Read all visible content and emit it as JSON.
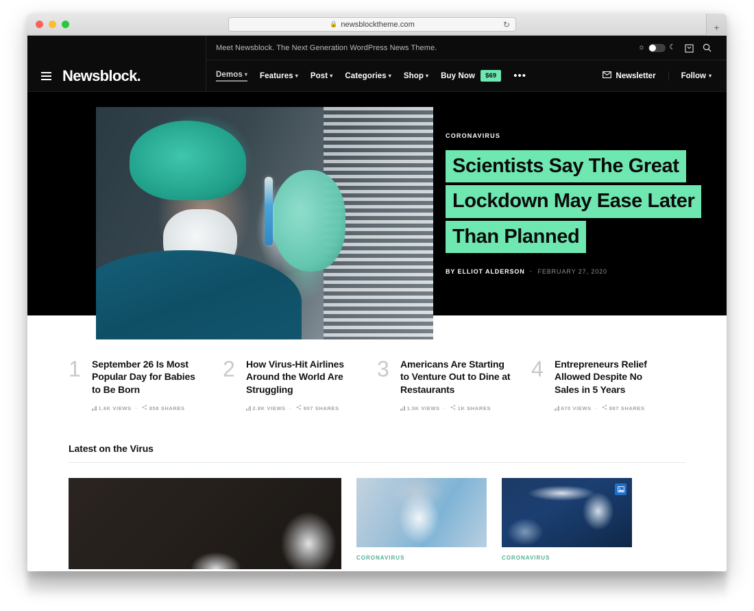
{
  "browser": {
    "url": "newsblocktheme.com",
    "lock_icon": "lock-icon",
    "reload_icon": "reload-icon",
    "newtab_icon": "plus-icon"
  },
  "topbar": {
    "tagline": "Meet Newsblock. The Next Generation WordPress News Theme.",
    "sun_icon": "sun-icon",
    "moon_icon": "moon-icon",
    "cart_icon": "shopping-bag-icon",
    "search_icon": "search-icon",
    "theme_toggle_state": "light"
  },
  "header": {
    "logo": "Newsblock.",
    "menu_icon": "hamburger-icon",
    "menu": [
      {
        "label": "Demos",
        "caret": "⌄",
        "active": true
      },
      {
        "label": "Features",
        "caret": "⌄",
        "active": false
      },
      {
        "label": "Post",
        "caret": "⌄",
        "active": false
      },
      {
        "label": "Categories",
        "caret": "⌄",
        "active": false
      },
      {
        "label": "Shop",
        "caret": "⌄",
        "active": false
      },
      {
        "label": "Buy Now",
        "caret": "",
        "badge": "$69",
        "active": false
      }
    ],
    "more_icon": "•••",
    "newsletter_label": "Newsletter",
    "newsletter_icon": "envelope-icon",
    "follow_label": "Follow",
    "follow_caret": "⌄"
  },
  "hero": {
    "category": "CORONAVIRUS",
    "title_lines": [
      "Scientists Say The Great",
      "Lockdown May Ease Later",
      "Than Planned"
    ],
    "by_prefix": "BY",
    "author": "ELLIOT ALDERSON",
    "separator": "·",
    "date": "FEBRUARY 27, 2020",
    "accent_color": "#6ee7b0"
  },
  "numbered_stories": [
    {
      "number": "1",
      "title": "September 26 Is Most Popular Day for Babies to Be Born",
      "views": "1.6K VIEWS",
      "shares": "858 SHARES"
    },
    {
      "number": "2",
      "title": "How Virus-Hit Airlines Around the World Are Struggling",
      "views": "2.8K VIEWS",
      "shares": "907 SHARES"
    },
    {
      "number": "3",
      "title": "Americans Are Starting to Venture Out to Dine at Restaurants",
      "views": "1.5K VIEWS",
      "shares": "1K SHARES"
    },
    {
      "number": "4",
      "title": "Entrepreneurs Relief Allowed Despite No Sales in 5 Years",
      "views": "670 VIEWS",
      "shares": "887 SHARES"
    }
  ],
  "latest_section": {
    "heading": "Latest on the Virus",
    "cards": [
      {
        "category": "",
        "thumb": "worker-in-protective-suit-dark"
      },
      {
        "category": "CORONAVIRUS",
        "thumb": "person-with-respirator-mask"
      },
      {
        "category": "CORONAVIRUS",
        "thumb": "scientist-in-laboratory",
        "badge_icon": "gallery-icon"
      }
    ]
  },
  "icons": {
    "views_icon": "bar-chart-icon",
    "shares_icon": "share-icon",
    "mid_dot": "·"
  }
}
